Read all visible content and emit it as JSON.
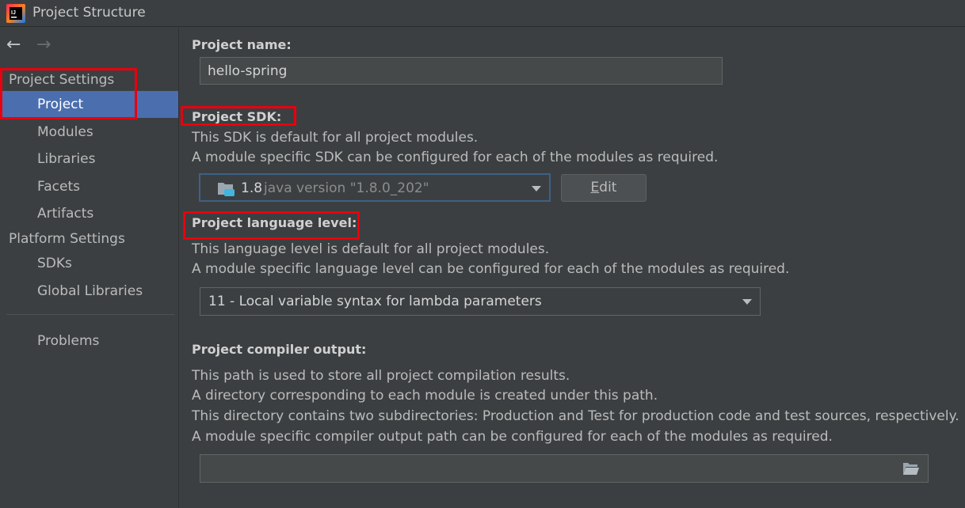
{
  "window": {
    "title": "Project Structure",
    "icon": "intellij-idea-icon"
  },
  "nav": {
    "back_icon": "arrow-left-icon",
    "forward_icon": "arrow-right-icon"
  },
  "sidebar": {
    "project_settings_header": "Project Settings",
    "project_settings_items": [
      "Project",
      "Modules",
      "Libraries",
      "Facets",
      "Artifacts"
    ],
    "platform_settings_header": "Platform Settings",
    "platform_settings_items": [
      "SDKs",
      "Global Libraries"
    ],
    "problems": "Problems",
    "selected": "Project"
  },
  "main": {
    "project_name": {
      "label": "Project name:",
      "value": "hello-spring"
    },
    "project_sdk": {
      "label": "Project SDK:",
      "desc1": "This SDK is default for all project modules.",
      "desc2": "A module specific SDK can be configured for each of the modules as required.",
      "selected_version": "1.8",
      "selected_detail": "java version \"1.8.0_202\"",
      "edit_button_prefix": "E",
      "edit_button_rest": "dit"
    },
    "language_level": {
      "label": "Project language level:",
      "desc1": "This language level is default for all project modules.",
      "desc2": "A module specific language level can be configured for each of the modules as required.",
      "selected": "11 - Local variable syntax for lambda parameters"
    },
    "compiler_output": {
      "label": "Project compiler output:",
      "desc1": "This path is used to store all project compilation results.",
      "desc2": "A directory corresponding to each module is created under this path.",
      "desc3": "This directory contains two subdirectories: Production and Test for production code and test sources, respectively.",
      "desc4": "A module specific compiler output path can be configured for each of the modules as required.",
      "value": ""
    }
  },
  "colors": {
    "background": "#3c3f41",
    "selection": "#4b6eaf",
    "highlight_box": "#e8000d",
    "text": "#bbbbbb"
  }
}
